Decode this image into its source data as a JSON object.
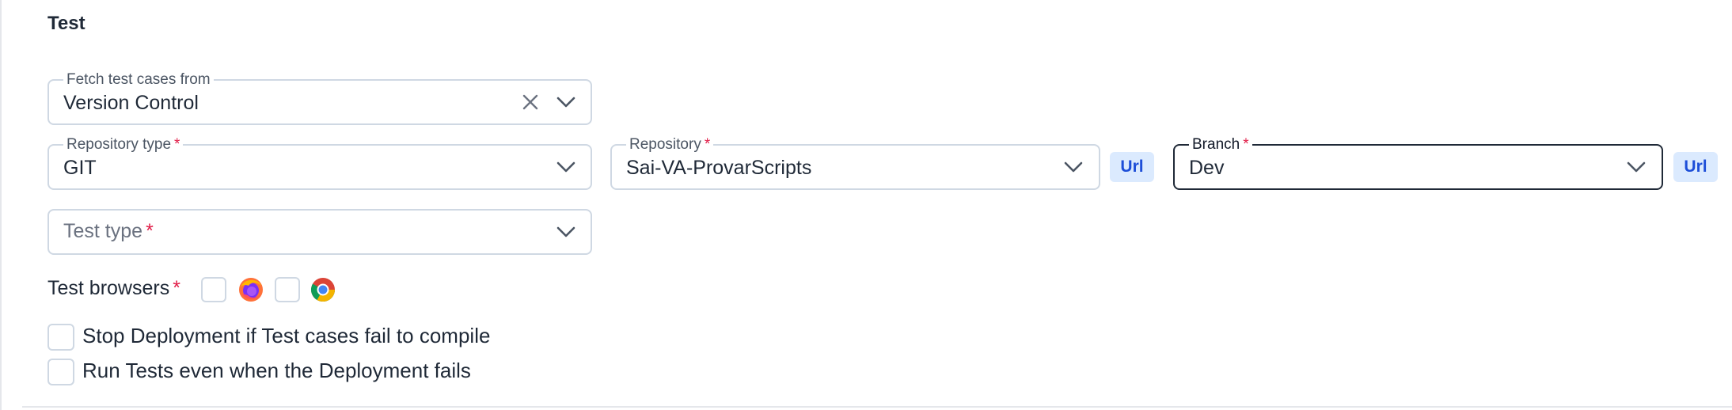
{
  "section": {
    "title": "Test"
  },
  "fetch_field": {
    "label": "Fetch test cases from",
    "value": "Version Control"
  },
  "repo_type_field": {
    "label": "Repository type",
    "required_mark": "*",
    "value": "GIT"
  },
  "repository_field": {
    "label": "Repository",
    "required_mark": "*",
    "value": "Sai-VA-ProvarScripts",
    "url_label": "Url"
  },
  "branch_field": {
    "label": "Branch",
    "required_mark": "*",
    "value": "Dev",
    "url_label": "Url"
  },
  "test_type_field": {
    "placeholder": "Test type",
    "required_mark": "*"
  },
  "test_browsers": {
    "label": "Test browsers",
    "required_mark": "*",
    "options": [
      {
        "icon": "firefox-icon",
        "checked": false
      },
      {
        "icon": "chrome-icon",
        "checked": false
      }
    ]
  },
  "options": {
    "stop_deployment": {
      "label": "Stop Deployment if Test cases fail to compile",
      "checked": false
    },
    "run_tests": {
      "label": "Run Tests even when the Deployment fails",
      "checked": false
    }
  },
  "colors": {
    "accent": "#1d4ed8",
    "url_bg": "#dbeafe",
    "required": "#e11d48",
    "border": "#cfd8e3"
  }
}
